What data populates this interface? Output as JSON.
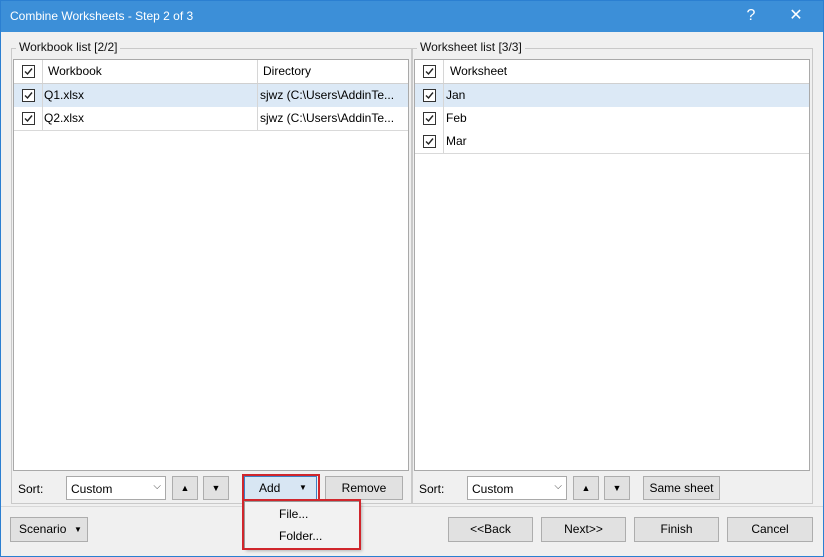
{
  "window": {
    "title": "Combine Worksheets - Step 2 of 3",
    "help_label": "?",
    "close_label": "✕"
  },
  "workbook_panel": {
    "label": "Workbook list [2/2]",
    "columns": [
      "Workbook",
      "Directory"
    ],
    "rows": [
      {
        "checked": true,
        "name": "Q1.xlsx",
        "dir": "sjwz (C:\\Users\\AddinTe..."
      },
      {
        "checked": true,
        "name": "Q2.xlsx",
        "dir": "sjwz (C:\\Users\\AddinTe..."
      }
    ],
    "sort_label": "Sort:",
    "sort_value": "Custom",
    "up_label": "▲",
    "down_label": "▼",
    "add_label": "Add",
    "remove_label": "Remove"
  },
  "worksheet_panel": {
    "label": "Worksheet list [3/3]",
    "columns": [
      "Worksheet"
    ],
    "rows": [
      {
        "checked": true,
        "name": "Jan"
      },
      {
        "checked": true,
        "name": "Feb"
      },
      {
        "checked": true,
        "name": "Mar"
      }
    ],
    "sort_label": "Sort:",
    "sort_value": "Custom",
    "up_label": "▲",
    "down_label": "▼",
    "same_sheet_label": "Same sheet"
  },
  "add_menu": {
    "items": [
      "File...",
      "Folder..."
    ]
  },
  "footer": {
    "scenario_label": "Scenario",
    "back_label": "<<Back",
    "next_label": "Next>>",
    "finish_label": "Finish",
    "cancel_label": "Cancel"
  },
  "colors": {
    "titlebar": "#3c8fd8",
    "selection": "#dce9f6",
    "highlight_outline": "#d0262c"
  }
}
